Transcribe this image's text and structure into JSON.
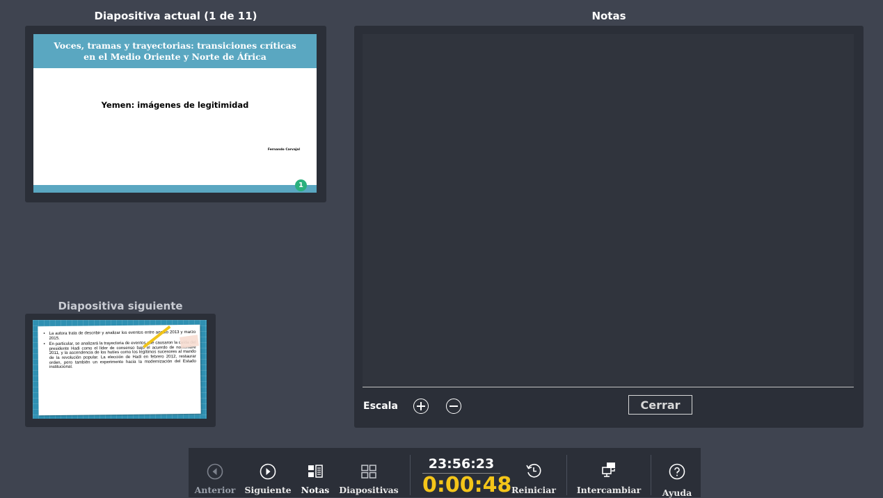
{
  "headings": {
    "current_slide": "Diapositiva actual (1 de 11)",
    "notes": "Notas",
    "next_slide": "Diapositiva siguiente"
  },
  "current_slide": {
    "title": "Voces, tramas y trayectorias: transiciones críticas en el Medio Oriente y Norte de África",
    "subtitle": "Yemen: imágenes de legitimidad",
    "author": "Fernando Carvajal",
    "number": "1"
  },
  "next_slide": {
    "bullets": [
      "La autora trata de describir y analizar los eventos entre agosto 2013 y marzo 2015.",
      "En particular, se analizará la trayectoria de eventos que causaron la caída del presidente Hadi como el líder de consenso bajo el acuerdo de noviembre 2011, y la ascendencia de los hutíes como los legítimos sucesores al mando de la revolución popular. La elección de Hadi en febrero 2012, restaurar orden, pero también un experimento hacia la modernización del Estado institucional."
    ]
  },
  "notes_panel": {
    "scale_label": "Escala",
    "close_label": "Cerrar"
  },
  "toolbar": {
    "prev_label": "Anterior",
    "next_label": "Siguiente",
    "notes_label": "Notas",
    "slides_label": "Diapositivas",
    "clock": "23:56:23",
    "elapsed": "0:00:48",
    "restart_label": "Reiniciar",
    "swap_label": "Intercambiar",
    "help_label": "Ayuda"
  },
  "colors": {
    "background": "#3f4450",
    "panel": "#2b2f38",
    "slide_accent": "#5aa7c1",
    "elapsed_timer": "#f4c519",
    "slide_number_badge": "#2bb07e"
  }
}
